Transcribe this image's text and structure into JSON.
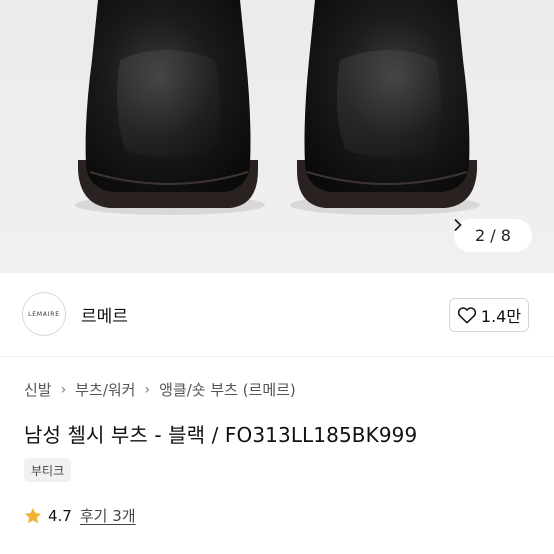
{
  "gallery": {
    "counter": "2 / 8"
  },
  "shop": {
    "logo_text": "LEMAIRE",
    "name": "르메르",
    "likes": "1.4만"
  },
  "breadcrumb": [
    "신발",
    "부츠/워커",
    "앵클/숏 부츠 (르메르)"
  ],
  "product": {
    "title": "남성 첼시 부츠 - 블랙 / FO313LL185BK999",
    "tag": "부티크",
    "rating": "4.7",
    "reviews": "후기 3개"
  },
  "colors": {
    "star": "#f2b134",
    "boot": "#161616"
  }
}
